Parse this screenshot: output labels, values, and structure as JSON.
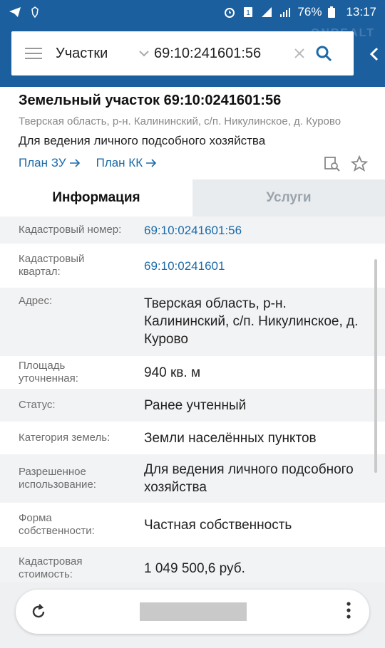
{
  "statusbar": {
    "battery": "76%",
    "time": "13:17"
  },
  "header": {
    "watermark": "ONREALT",
    "search_type": "Участки",
    "search_value": "69:10:241601:56"
  },
  "card": {
    "title": "Земельный участок 69:10:0241601:56",
    "address": "Тверская область, р-н. Калининский, с/п. Никулинское, д. Курово",
    "use": "Для ведения личного подсобного хозяйства",
    "link_plan_zu": "План ЗУ",
    "link_plan_kk": "План КК"
  },
  "tabs": {
    "info": "Информация",
    "services": "Услуги"
  },
  "info": {
    "rows": [
      {
        "key": "Кадастровый номер:",
        "value": "69:10:0241601:56"
      },
      {
        "key": "Кадастровый квартал:",
        "value": "69:10:0241601"
      },
      {
        "key": "Адрес:",
        "value": "Тверская область, р-н. Калининский, с/п. Никулинское, д. Курово"
      },
      {
        "key": "Площадь уточненная:",
        "value": "940 кв. м"
      },
      {
        "key": "Статус:",
        "value": "Ранее учтенный"
      },
      {
        "key": "Категория земель:",
        "value": "Земли населённых пунктов"
      },
      {
        "key": "Разрешенное использование:",
        "value": "Для ведения личного подсобного хозяйства"
      },
      {
        "key": "Форма собственности:",
        "value": "Частная собственность"
      },
      {
        "key": "Кадастровая стоимость:",
        "value": "1 049 500,6 руб."
      }
    ]
  },
  "colors": {
    "primary": "#1b5f9e",
    "link": "#1b6aa8"
  }
}
